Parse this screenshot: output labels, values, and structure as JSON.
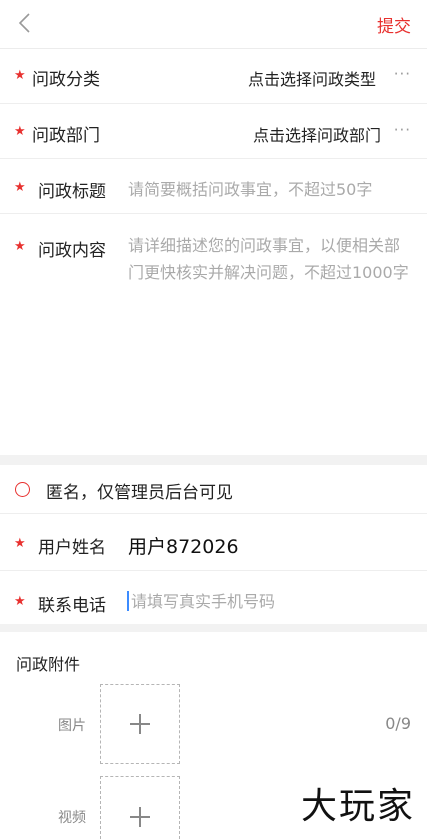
{
  "header": {
    "submit_label": "提交"
  },
  "form": {
    "category": {
      "label": "问政分类",
      "value": "点击选择问政类型",
      "more": "···"
    },
    "department": {
      "label": "问政部门",
      "value": "点击选择问政部门",
      "more": "···"
    },
    "title": {
      "label": "问政标题",
      "placeholder": "请简要概括问政事宜，不超过50字"
    },
    "content": {
      "label": "问政内容",
      "placeholder": "请详细描述您的问政事宜，以便相关部门更快核实并解决问题，不超过1000字"
    },
    "anonymous": {
      "label": "匿名，仅管理员后台可见",
      "checked": false
    },
    "username": {
      "label": "用户姓名",
      "value": "用户872026"
    },
    "phone": {
      "label": "联系电话",
      "placeholder": "请填写真实手机号码"
    }
  },
  "attachments": {
    "title": "问政附件",
    "image_label": "图片",
    "image_count": "0/9",
    "video_label": "视频"
  },
  "watermark": "大玩家",
  "colors": {
    "accent": "#e8312f",
    "separator": "#f2f2f2",
    "cursor": "#3c8cff"
  }
}
